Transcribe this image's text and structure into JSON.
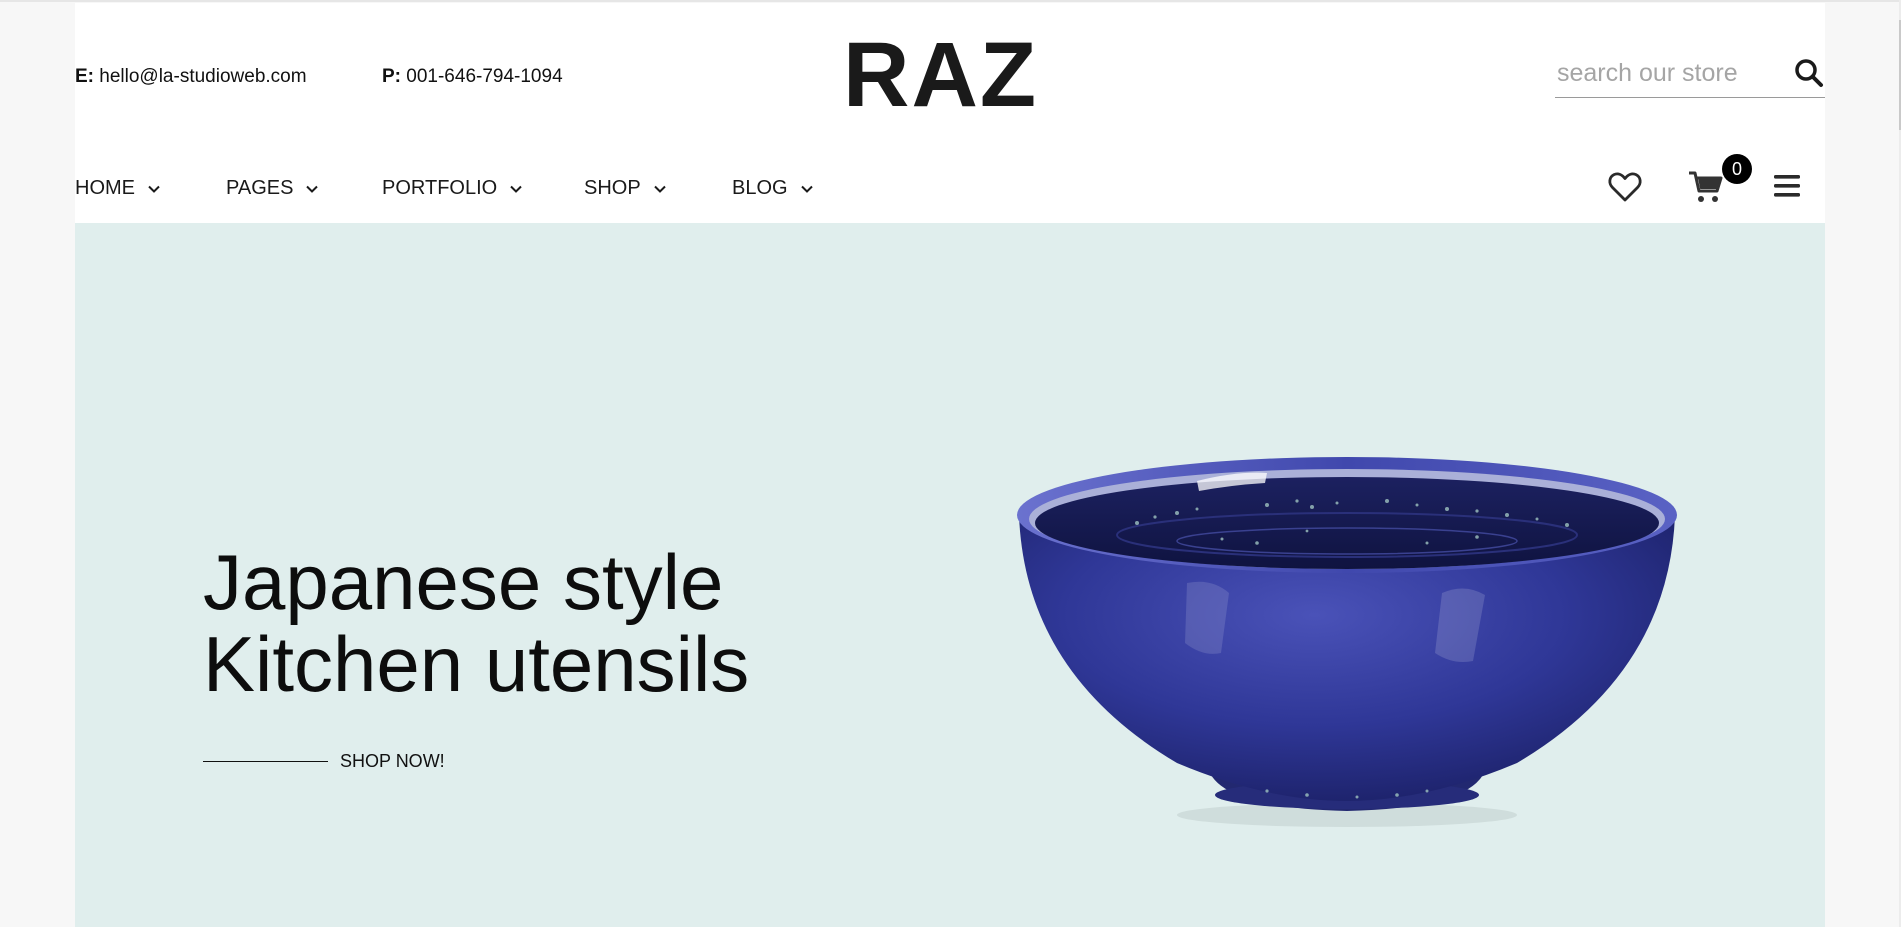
{
  "header": {
    "email_label": "E:",
    "email_value": "hello@la-studioweb.com",
    "phone_label": "P:",
    "phone_value": "001-646-794-1094",
    "logo": "RAZ"
  },
  "search": {
    "placeholder": "search our store",
    "icon": "search-icon"
  },
  "nav": {
    "items": [
      {
        "label": "HOME"
      },
      {
        "label": "PAGES"
      },
      {
        "label": "PORTFOLIO"
      },
      {
        "label": "SHOP"
      },
      {
        "label": "BLOG"
      }
    ]
  },
  "actions": {
    "wishlist_icon": "heart-icon",
    "cart_icon": "cart-icon",
    "cart_count": "0",
    "menu_icon": "hamburger-menu-icon"
  },
  "hero": {
    "title_line1": "Japanese style",
    "title_line2": "Kitchen utensils",
    "cta_label": "SHOP NOW!",
    "background": "#e0eeed",
    "image": "blue ceramic bowl"
  },
  "colors": {
    "text": "#111111",
    "badge": "#000000",
    "bowl": "#2d3590"
  }
}
